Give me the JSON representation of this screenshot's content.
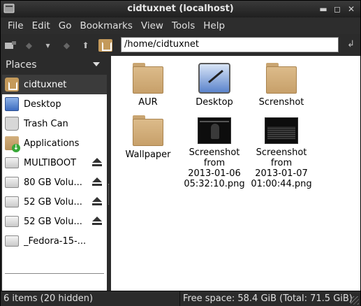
{
  "window": {
    "title": "cidtuxnet (localhost)"
  },
  "titlebar_buttons": [
    "minimize-icon",
    "maximize-icon",
    "close-icon"
  ],
  "menubar": {
    "items": [
      "File",
      "Edit",
      "Go",
      "Bookmarks",
      "View",
      "Tools",
      "Help"
    ]
  },
  "toolbar": {
    "path": "/home/cidtuxnet",
    "buttons": [
      "new-tab-icon",
      "back-icon",
      "history-dropdown-icon",
      "forward-icon",
      "up-icon",
      "home-icon"
    ],
    "go_icon": "go-icon"
  },
  "sidebar": {
    "header": "Places",
    "items": [
      {
        "label": "cidtuxnet",
        "icon": "home-folder-icon",
        "selected": true,
        "eject": false
      },
      {
        "label": "Desktop",
        "icon": "desktop-icon",
        "eject": false
      },
      {
        "label": "Trash Can",
        "icon": "trash-icon",
        "eject": false
      },
      {
        "label": "Applications",
        "icon": "applications-icon",
        "eject": false
      },
      {
        "label": "MULTIBOOT",
        "icon": "drive-icon",
        "eject": true
      },
      {
        "label": "80 GB Volu...",
        "icon": "drive-icon",
        "eject": true
      },
      {
        "label": "52 GB Volu...",
        "icon": "drive-icon",
        "eject": true
      },
      {
        "label": "52 GB Volu...",
        "icon": "drive-icon",
        "eject": true
      },
      {
        "label": "_Fedora-15-...",
        "icon": "drive-icon",
        "eject": false
      }
    ]
  },
  "files": [
    {
      "name": "AUR",
      "type": "folder"
    },
    {
      "name": "Desktop",
      "type": "desktop"
    },
    {
      "name": "Screnshot",
      "type": "folder"
    },
    {
      "name": "Wallpaper",
      "type": "folder"
    },
    {
      "name": "Screenshot\nfrom\n2013-01-06\n05:32:10.png",
      "type": "image"
    },
    {
      "name": "Screenshot\nfrom\n2013-01-07\n01:00:44.png",
      "type": "image"
    }
  ],
  "statusbar": {
    "items_text": "6 items (20 hidden)",
    "free_space_text": "Free space: 58.4 GiB (Total: 71.5 GiB)"
  }
}
